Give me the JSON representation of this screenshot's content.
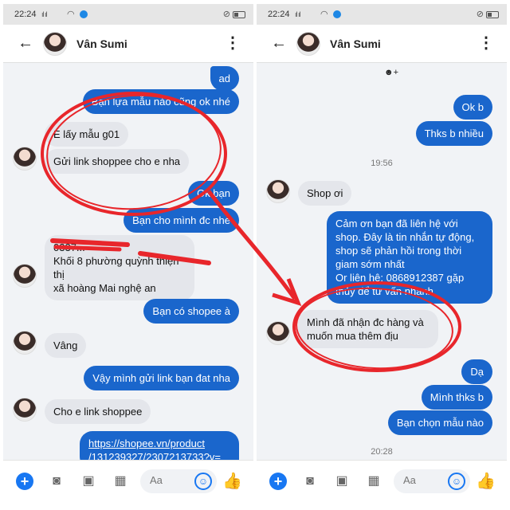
{
  "status": {
    "time": "22:24",
    "signal": "ıl ıl",
    "wifi_icon": "wifi-icon",
    "alarm_icon": "silent-icon"
  },
  "contact": {
    "name": "Vân Sumi"
  },
  "left": {
    "messages": [
      {
        "dir": "out",
        "text": "ad"
      },
      {
        "dir": "out",
        "text": "Bạn lựa mẫu nào cũng ok nhé"
      },
      {
        "dir": "in",
        "text": "E lấy mẫu g01"
      },
      {
        "dir": "in",
        "text": "Gửi link shoppee cho e nha"
      },
      {
        "dir": "out",
        "text": "Ok bạn"
      },
      {
        "dir": "out",
        "text": "Bạn cho mình đc nhé"
      },
      {
        "dir": "in",
        "lines": [
          "0337...",
          "Khối 8 phường quỳnh thiện thị",
          "xã hoàng Mai nghệ an"
        ]
      },
      {
        "dir": "out",
        "text": "Bạn có shopee à"
      },
      {
        "dir": "in",
        "text": "Vâng"
      },
      {
        "dir": "out",
        "text": "Vậy mình gửi link bạn đat nha"
      },
      {
        "dir": "in",
        "text": "Cho e link shoppee"
      },
      {
        "dir": "out",
        "lines": [
          "https://shopee.vn/product",
          "/131239327/2307213733?v="
        ]
      }
    ]
  },
  "right": {
    "reaction": "☻+",
    "messages": [
      {
        "dir": "out",
        "text": "Ok b"
      },
      {
        "dir": "out",
        "text": "Thks b nhiều"
      },
      {
        "dir": "ts",
        "text": "19:56"
      },
      {
        "dir": "in",
        "text": "Shop ơi"
      },
      {
        "dir": "out",
        "lines": [
          "Cảm ơn bạn đã liên hệ với",
          "shop. Đây là tin nhắn tự động,",
          "shop sẽ phản hồi trong thời",
          "giam sớm nhất",
          "Or liên hệ: 0868912387 gặp",
          "thủy để tư vấn nhanh"
        ]
      },
      {
        "dir": "in",
        "lines": [
          "Mình đã nhận đc hàng và",
          "muốn mua thêm địu"
        ]
      },
      {
        "dir": "out",
        "text": "Dạ"
      },
      {
        "dir": "out",
        "text": "Mình thks b"
      },
      {
        "dir": "out",
        "text": "Bạn chọn mẫu nào"
      },
      {
        "dir": "ts",
        "text": "20:28"
      }
    ]
  },
  "composer": {
    "placeholder": "Aa",
    "icons": [
      "plus-icon",
      "camera-icon",
      "image-icon",
      "microphone-icon",
      "emoji-icon",
      "like-icon"
    ]
  },
  "colors": {
    "outgoing": "#1a66cc",
    "incoming": "#e4e6eb",
    "accent": "#1877f2",
    "annotation": "#e8262b"
  }
}
